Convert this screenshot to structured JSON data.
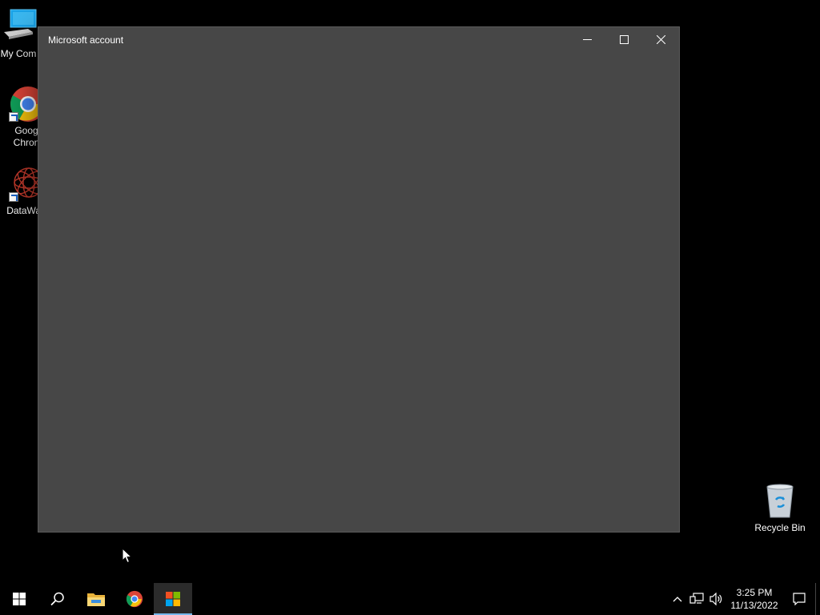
{
  "desktop": {
    "icons": [
      {
        "label": "My Com",
        "icon": "computer-icon"
      },
      {
        "label": "Goog\nChron",
        "icon": "chrome-icon"
      },
      {
        "label": "DataWag",
        "icon": "datawagon-icon"
      },
      {
        "label": "Recycle Bin",
        "icon": "recycle-bin-icon"
      }
    ]
  },
  "window": {
    "title": "Microsoft account",
    "controls": [
      "minimize-icon",
      "maximize-icon",
      "close-icon"
    ],
    "background": "#474747"
  },
  "taskbar": {
    "pinned": [
      "windows-start-icon",
      "search-icon",
      "file-explorer-icon",
      "chrome-icon",
      "microsoft-store-icon"
    ],
    "active": "microsoft-store-icon",
    "tray": [
      "chevron-up-icon",
      "network-icon",
      "volume-icon"
    ],
    "clock": {
      "time": "3:25 PM",
      "date": "11/13/2022"
    },
    "notification_icon": "action-center-icon"
  },
  "colors": {
    "accent": "#76b9ed",
    "taskbar": "#000000"
  }
}
